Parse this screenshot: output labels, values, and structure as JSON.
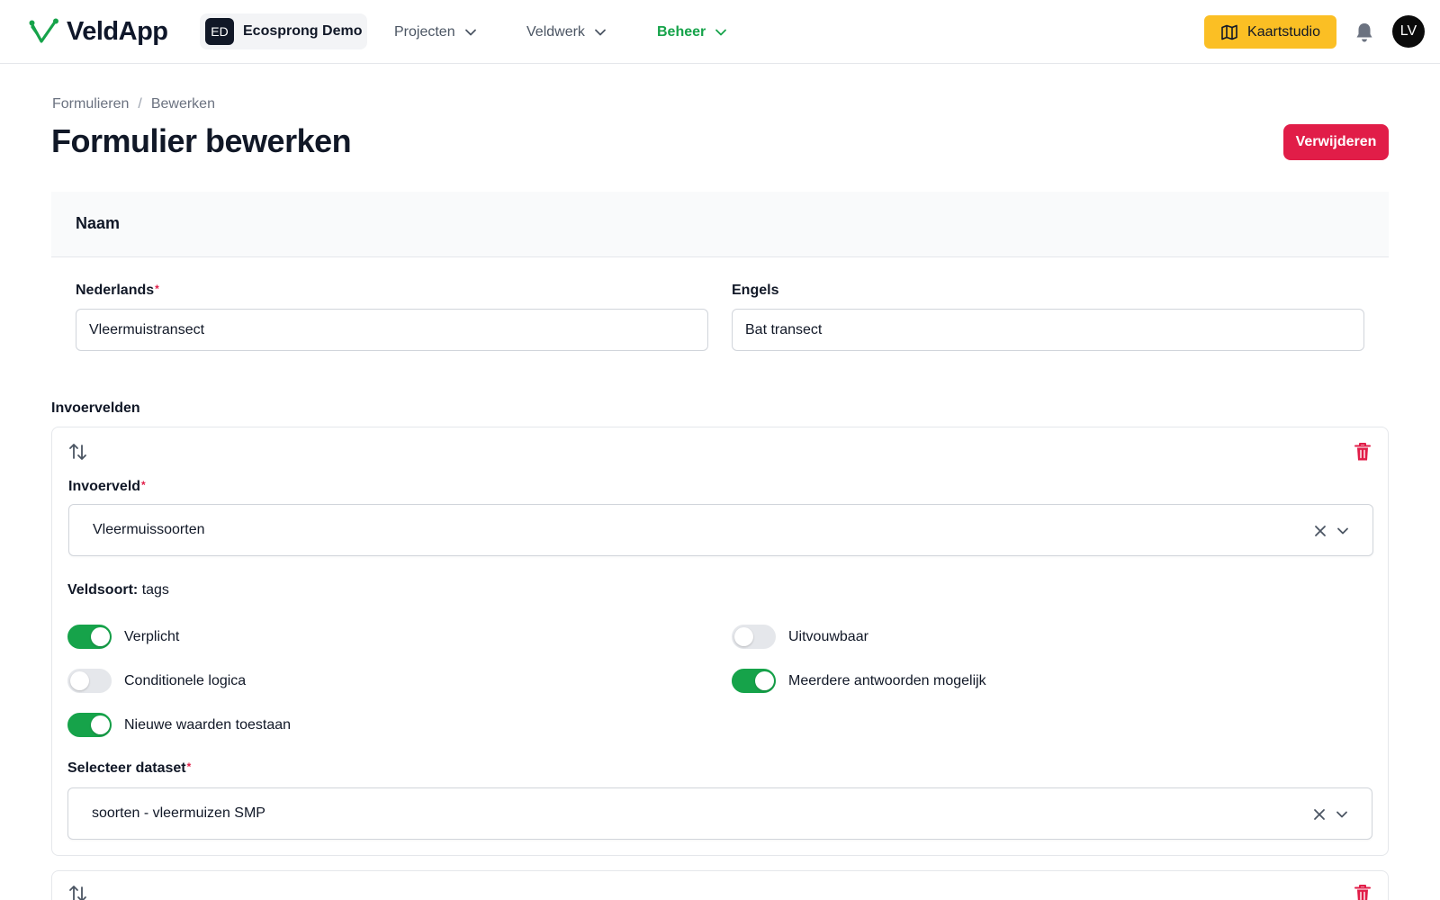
{
  "app": {
    "name": "VeldApp"
  },
  "org": {
    "badge": "ED",
    "name": "Ecosprong Demo"
  },
  "nav": [
    {
      "label": "Projecten",
      "active": false
    },
    {
      "label": "Veldwerk",
      "active": false
    },
    {
      "label": "Beheer",
      "active": true
    }
  ],
  "header_actions": {
    "kaartstudio": "Kaartstudio",
    "avatar": "LV"
  },
  "breadcrumb": {
    "first": "Formulieren",
    "separator": "/",
    "second": "Bewerken"
  },
  "page": {
    "title": "Formulier bewerken",
    "delete_label": "Verwijderen"
  },
  "naam": {
    "heading": "Naam",
    "nl_label": "Nederlands",
    "nl_value": "Vleermuistransect",
    "en_label": "Engels",
    "en_value": "Bat transect"
  },
  "required_mark": "*",
  "invoervelden": {
    "label": "Invoervelden",
    "fields": [
      {
        "invoerveld_label": "Invoerveld",
        "invoerveld_value": "Vleermuissoorten",
        "veldsoort_label": "Veldsoort:",
        "veldsoort_value": "tags",
        "toggles": {
          "verplicht": {
            "label": "Verplicht",
            "on": true
          },
          "uitvouwbaar": {
            "label": "Uitvouwbaar",
            "on": false
          },
          "conditionele": {
            "label": "Conditionele logica",
            "on": false
          },
          "meerdere": {
            "label": "Meerdere antwoorden mogelijk",
            "on": true
          },
          "nieuwe": {
            "label": "Nieuwe waarden toestaan",
            "on": true
          }
        },
        "dataset_label": "Selecteer dataset",
        "dataset_value": "soorten - vleermuizen SMP"
      }
    ]
  },
  "colors": {
    "brand_green": "#16a34a",
    "danger": "#e11d48",
    "accent_yellow": "#fbbf24"
  },
  "icons": [
    "veldapp-logo-icon",
    "chevron-down-icon",
    "map-icon",
    "bell-icon",
    "sort-arrows-icon",
    "trash-icon",
    "close-icon"
  ]
}
